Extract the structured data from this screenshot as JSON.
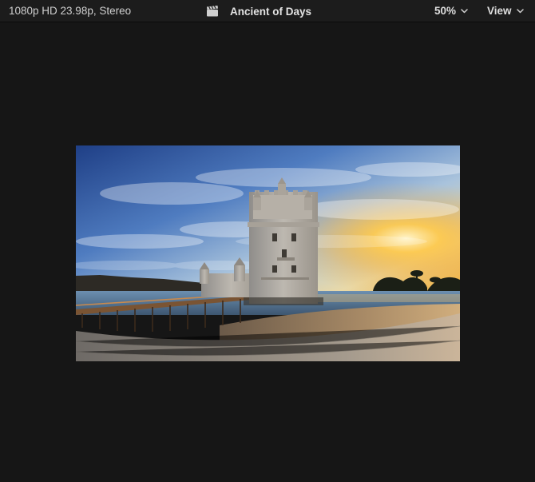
{
  "toolbar": {
    "format_info": "1080p HD 23.98p, Stereo",
    "title": "Ancient of Days",
    "zoom": "50%",
    "view_label": "View"
  },
  "icons": {
    "clapper": "clapperboard-icon",
    "zoom_menu": "chevron-down-icon",
    "view_menu": "chevron-down-icon"
  },
  "viewer": {
    "frame_description_name": "video-frame"
  },
  "colors": {
    "toolbar_bg": "#1c1c1c",
    "viewer_bg": "#161616",
    "text": "#dedede"
  }
}
